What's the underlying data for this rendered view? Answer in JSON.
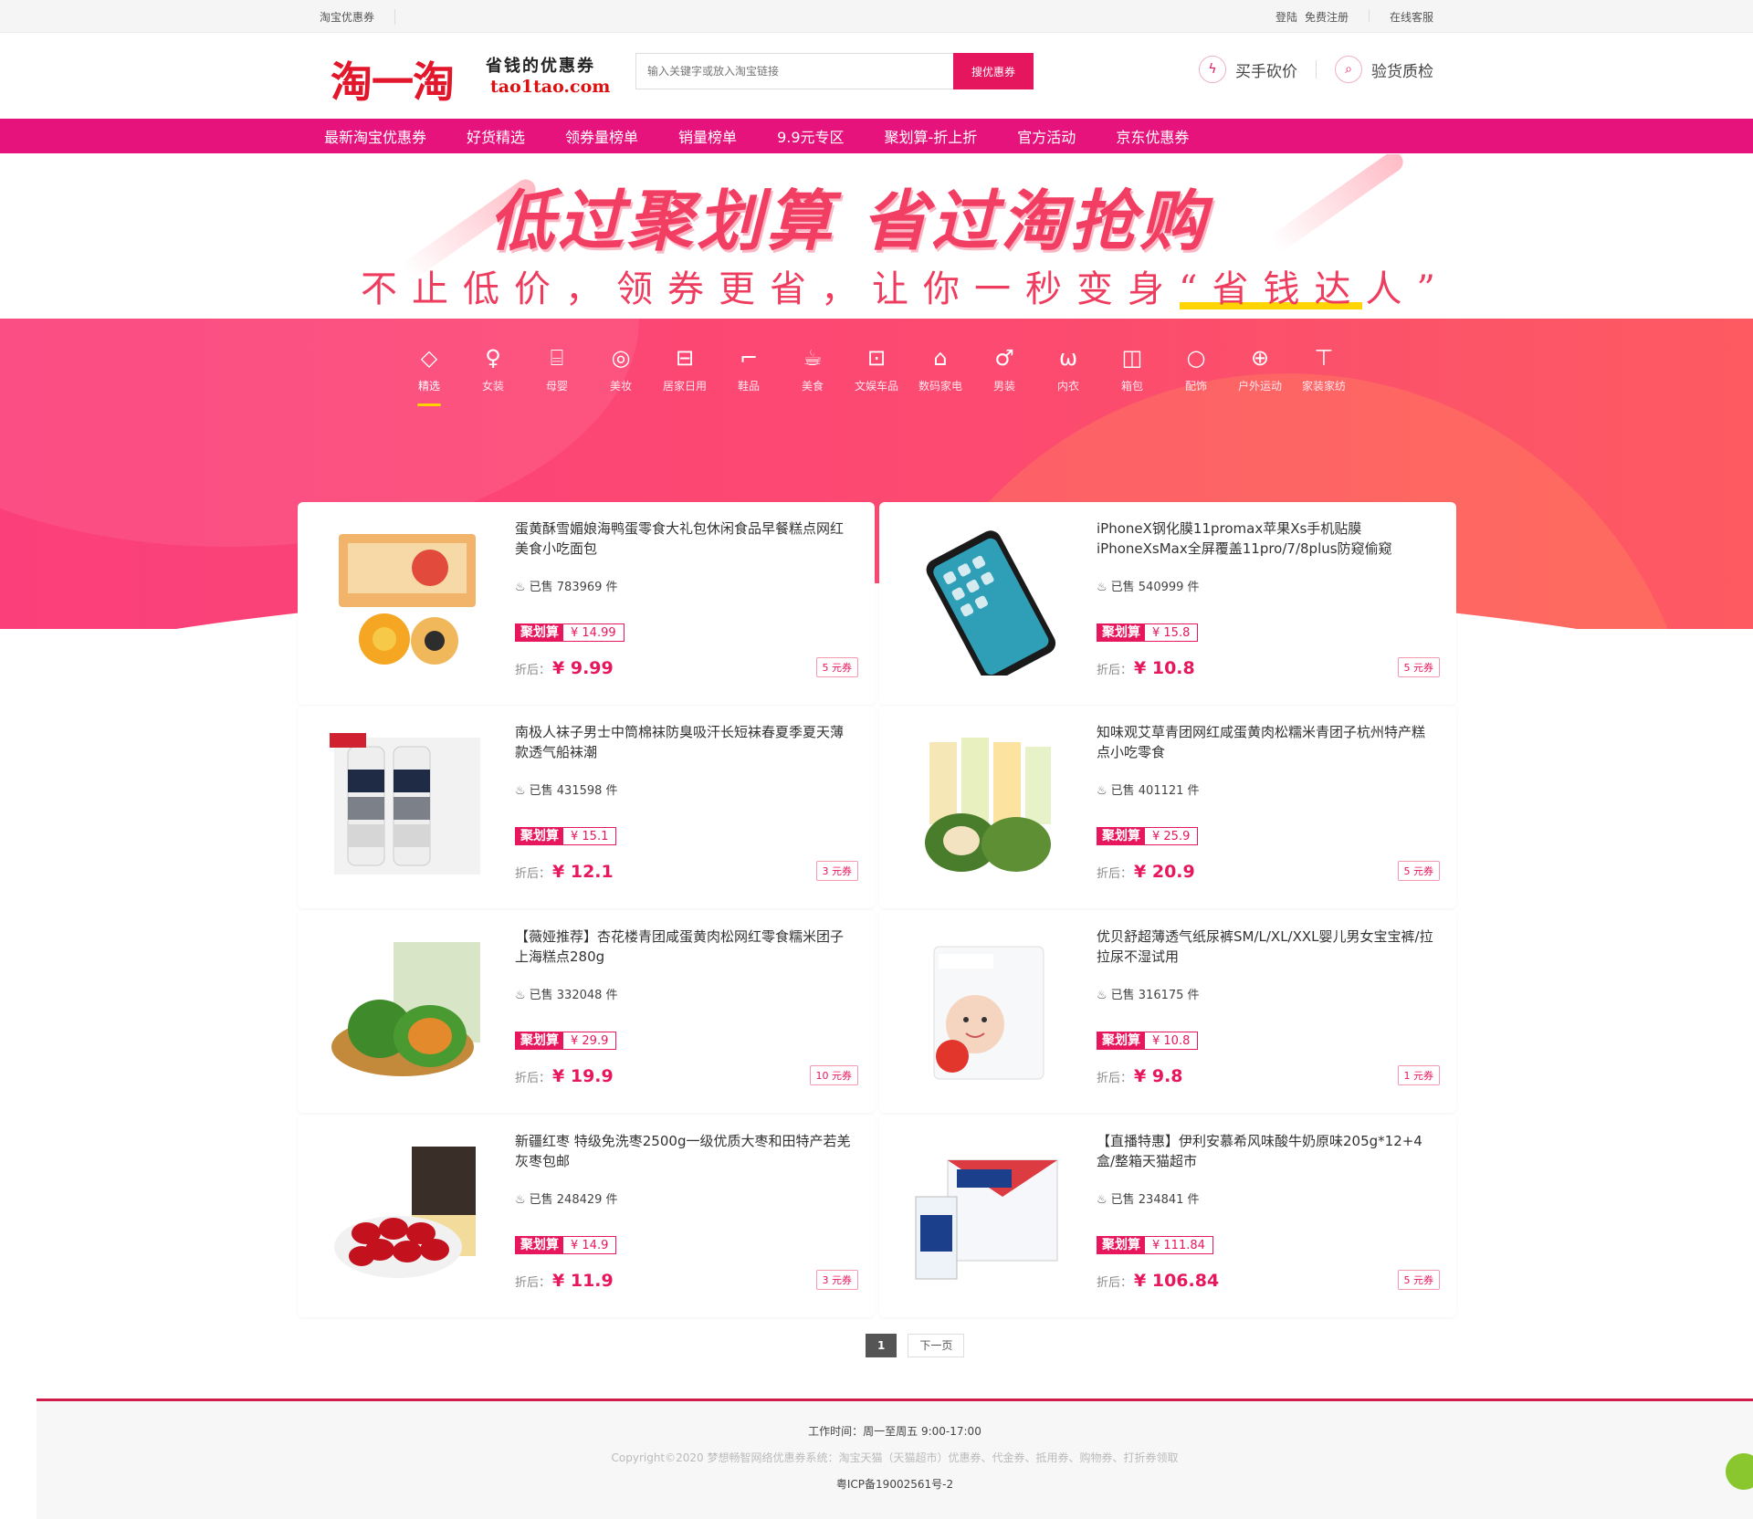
{
  "topbar": {
    "left": "淘宝优惠券",
    "login": "登陆",
    "register": "免费注册",
    "service": "在线客服"
  },
  "header": {
    "logo_cn": "淘一淘",
    "logo_slogan": "省钱的优惠券",
    "logo_domain": "tao1tao.com",
    "search_placeholder": "输入关键字或放入淘宝链接",
    "search_button": "搜优惠券",
    "link1": "买手砍价",
    "link2": "验货质检"
  },
  "nav": [
    "最新淘宝优惠券",
    "好货精选",
    "领券量榜单",
    "销量榜单",
    "9.9元专区",
    "聚划算-折上折",
    "官方活动",
    "京东优惠券"
  ],
  "banner": {
    "title": "低过聚划算  省过淘抢购",
    "subtitle": "不止低价，领券更省，让你一秒变身“省钱达人”"
  },
  "categories": [
    {
      "label": "精选",
      "icon": "diamond-icon",
      "glyph": "◇"
    },
    {
      "label": "女装",
      "icon": "dress-icon",
      "glyph": "♀"
    },
    {
      "label": "母婴",
      "icon": "bottle-icon",
      "glyph": "⌸"
    },
    {
      "label": "美妆",
      "icon": "cosmetic-icon",
      "glyph": "◎"
    },
    {
      "label": "居家日用",
      "icon": "basket-icon",
      "glyph": "⊟"
    },
    {
      "label": "鞋品",
      "icon": "shoe-icon",
      "glyph": "⌐"
    },
    {
      "label": "美食",
      "icon": "cup-icon",
      "glyph": "☕"
    },
    {
      "label": "文娱车品",
      "icon": "car-icon",
      "glyph": "⊡"
    },
    {
      "label": "数码家电",
      "icon": "device-icon",
      "glyph": "⌂"
    },
    {
      "label": "男装",
      "icon": "shirt-icon",
      "glyph": "♂"
    },
    {
      "label": "内衣",
      "icon": "bra-icon",
      "glyph": "ω"
    },
    {
      "label": "箱包",
      "icon": "bag-icon",
      "glyph": "◫"
    },
    {
      "label": "配饰",
      "icon": "ring-icon",
      "glyph": "○"
    },
    {
      "label": "户外运动",
      "icon": "ball-icon",
      "glyph": "⊕"
    },
    {
      "label": "家装家纺",
      "icon": "roller-icon",
      "glyph": "⊤"
    }
  ],
  "products": [
    {
      "title": "蛋黄酥雪媚娘海鸭蛋零食大礼包休闲食品早餐糕点网红美食小吃面包",
      "sold": "已售 783969 件",
      "tag": "聚划算",
      "orig": "¥ 14.99",
      "final_label": "折后：",
      "final": "¥ 9.99",
      "coupon": "5 元券",
      "pic": "egg-yolk-pastry"
    },
    {
      "title": "iPhoneX钢化膜11promax苹果Xs手机贴膜iPhoneXsMax全屏覆盖11pro/7/8plus防窥偷窥",
      "sold": "已售 540999 件",
      "tag": "聚划算",
      "orig": "¥ 15.8",
      "final_label": "折后：",
      "final": "¥ 10.8",
      "coupon": "5 元券",
      "pic": "phone"
    },
    {
      "title": "南极人袜子男士中筒棉袜防臭吸汗长短袜春夏季夏天薄款透气船袜潮",
      "sold": "已售 431598 件",
      "tag": "聚划算",
      "orig": "¥ 15.1",
      "final_label": "折后：",
      "final": "¥ 12.1",
      "coupon": "3 元券",
      "pic": "socks"
    },
    {
      "title": "知味观艾草青团网红咸蛋黄肉松糯米青团子杭州特产糕点小吃零食",
      "sold": "已售 401121 件",
      "tag": "聚划算",
      "orig": "¥ 25.9",
      "final_label": "折后：",
      "final": "¥ 20.9",
      "coupon": "5 元券",
      "pic": "qingtuan"
    },
    {
      "title": "【薇娅推荐】杏花楼青团咸蛋黄肉松网红零食糯米团子上海糕点280g",
      "sold": "已售 332048 件",
      "tag": "聚划算",
      "orig": "¥ 29.9",
      "final_label": "折后：",
      "final": "¥ 19.9",
      "coupon": "10 元券",
      "pic": "qingtuan2"
    },
    {
      "title": "优贝舒超薄透气纸尿裤SM/L/XL/XXL婴儿男女宝宝裤/拉拉尿不湿试用",
      "sold": "已售 316175 件",
      "tag": "聚划算",
      "orig": "¥ 10.8",
      "final_label": "折后：",
      "final": "¥ 9.8",
      "coupon": "1 元券",
      "pic": "diaper"
    },
    {
      "title": "新疆红枣 特级免洗枣2500g一级优质大枣和田特产若羌灰枣包邮",
      "sold": "已售 248429 件",
      "tag": "聚划算",
      "orig": "¥ 14.9",
      "final_label": "折后：",
      "final": "¥ 11.9",
      "coupon": "3 元券",
      "pic": "dates"
    },
    {
      "title": "【直播特惠】伊利安慕希风味酸牛奶原味205g*12+4盒/整箱天猫超市",
      "sold": "已售 234841 件",
      "tag": "聚划算",
      "orig": "¥ 111.84",
      "final_label": "折后：",
      "final": "¥ 106.84",
      "coupon": "5 元券",
      "pic": "yogurt"
    }
  ],
  "pager": {
    "current": "1",
    "next": "下一页"
  },
  "footer": {
    "hours": "工作时间：周一至周五  9:00-17:00",
    "copyright": "Copyright©2020   梦想畅智网络优惠券系统：淘宝天猫（天猫超市）优惠券、代金券、抵用券、购物券、打折券领取",
    "icp": "粤ICP备19002561号-2"
  },
  "colors": {
    "brand": "#e6137d",
    "accent": "#e6175c",
    "highlight": "#ffd400"
  }
}
